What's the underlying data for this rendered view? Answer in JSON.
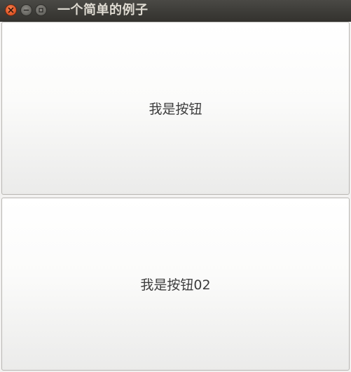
{
  "window": {
    "title": "一个简单的例子",
    "controls": {
      "close_icon": "close-icon",
      "minimize_icon": "minimize-icon",
      "maximize_icon": "maximize-icon"
    }
  },
  "main": {
    "buttons": [
      {
        "label": "我是按钮"
      },
      {
        "label": "我是按钮02"
      }
    ]
  },
  "colors": {
    "titlebar": "#3c3b37",
    "close_button": "#e55b2b",
    "title_text": "#dfdbd2"
  }
}
